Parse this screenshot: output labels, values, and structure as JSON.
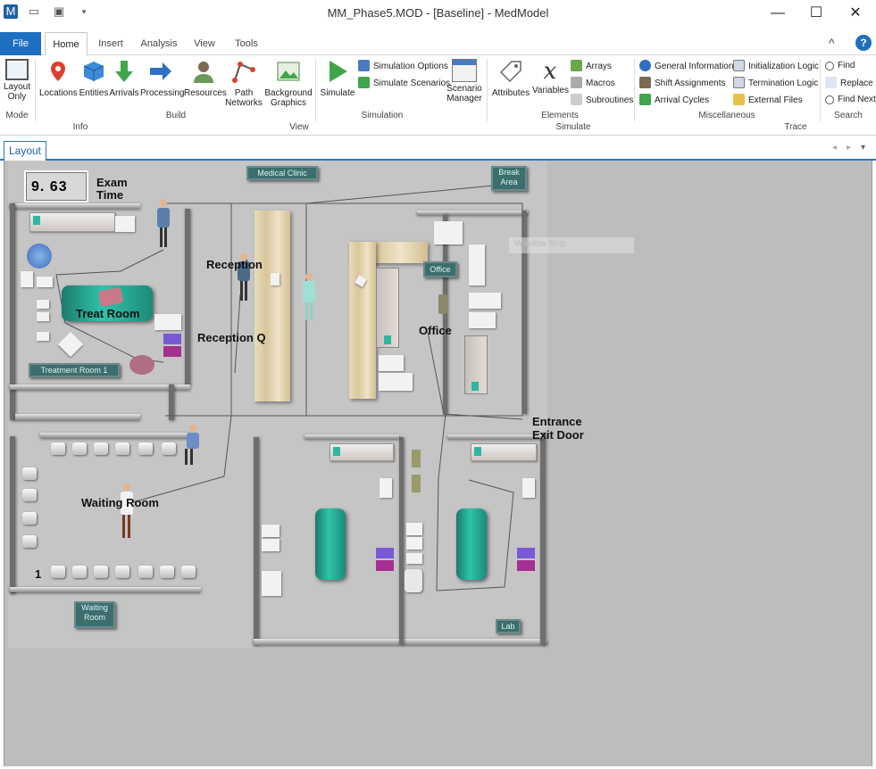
{
  "window": {
    "title": "MM_Phase5.MOD - [Baseline] - MedModel"
  },
  "quick_access": [
    "app-icon",
    "open-icon",
    "save-icon",
    "dropdown-icon"
  ],
  "window_controls": {
    "minimize": "—",
    "maximize": "☐",
    "close": "✕"
  },
  "ribbon_tabs": [
    "File",
    "Home",
    "Insert",
    "Analysis",
    "View",
    "Tools"
  ],
  "active_tab": "Home",
  "ribbon_right": {
    "collapse": "^",
    "help": "?"
  },
  "ribbon": {
    "mode": {
      "buttons": [
        {
          "label": "Layout Only",
          "icon": "layout-icon"
        }
      ],
      "group": "Mode"
    },
    "build": {
      "buttons": [
        {
          "label": "Locations",
          "icon": "location-pin-icon"
        },
        {
          "label": "Entities",
          "icon": "cube-icon"
        },
        {
          "label": "Arrivals",
          "icon": "arrow-down-icon"
        },
        {
          "label": "Processing",
          "icon": "arrow-right-icon"
        },
        {
          "label": "Resources",
          "icon": "person-icon"
        },
        {
          "label": "Path Networks",
          "icon": "path-network-icon"
        },
        {
          "label": "Background Graphics",
          "icon": "picture-icon"
        }
      ],
      "group": "Build"
    },
    "simulation": {
      "simulate": "Simulate",
      "options": "Simulation Options",
      "scenarios": "Simulate Scenarios",
      "group": "Simulation"
    },
    "scenario_manager": "Scenario Manager",
    "elements": {
      "attributes": "Attributes",
      "variables": "Variables",
      "arrays": "Arrays",
      "macros": "Macros",
      "subroutines": "Subroutines",
      "group": "Elements"
    },
    "misc": {
      "items": [
        "General Information",
        "Shift Assignments",
        "Arrival Cycles",
        "Initialization Logic",
        "Termination Logic",
        "External Files"
      ],
      "group": "Miscellaneous"
    },
    "search": {
      "items": [
        "Find",
        "Replace",
        "Find Next"
      ],
      "group": "Search"
    },
    "bottom_groups": [
      "Info",
      "View",
      "Simulate",
      "Trace"
    ]
  },
  "doc_tab": "Layout",
  "layout": {
    "counter_value": "9. 63",
    "counter_label": "Exam\nTime",
    "labels": {
      "treat_room": "Treat Room",
      "reception": "Reception",
      "reception_q": "Reception Q",
      "office": "Office",
      "entrance": "Entrance\nExit Door",
      "waiting_room": "Waiting Room",
      "waiting_count": "1"
    },
    "signs": {
      "medical_clinic": "Medical Clinic",
      "break_area": "Break\nArea",
      "office": "Office",
      "treatment_room": "Treatment Room 1",
      "waiting_room": "Waiting\nRoom",
      "lab": "Lab"
    },
    "ghost_text": "Window Snip"
  }
}
